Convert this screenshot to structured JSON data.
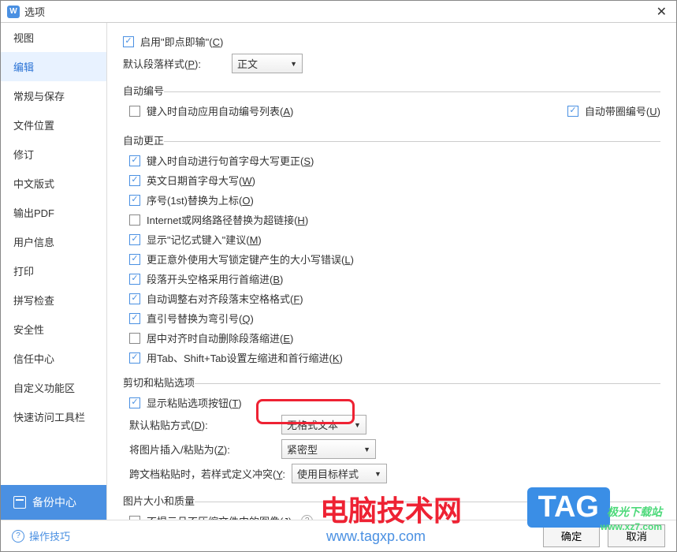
{
  "window": {
    "title": "选项",
    "close": "✕"
  },
  "sidebar": {
    "items": [
      {
        "label": "视图"
      },
      {
        "label": "编辑"
      },
      {
        "label": "常规与保存"
      },
      {
        "label": "文件位置"
      },
      {
        "label": "修订"
      },
      {
        "label": "中文版式"
      },
      {
        "label": "输出PDF"
      },
      {
        "label": "用户信息"
      },
      {
        "label": "打印"
      },
      {
        "label": "拼写检查"
      },
      {
        "label": "安全性"
      },
      {
        "label": "信任中心"
      },
      {
        "label": "自定义功能区"
      },
      {
        "label": "快速访问工具栏"
      }
    ],
    "backup": "备份中心"
  },
  "topRow": {
    "clickType": {
      "label": "启用\"即点即输\"(",
      "key": "C",
      "close": ")"
    },
    "paraStyle": {
      "label": "默认段落样式(",
      "key": "P",
      "close": "):",
      "value": "正文"
    }
  },
  "autoNum": {
    "legend": "自动编号",
    "applyList": {
      "label": "键入时自动应用自动编号列表(",
      "key": "A",
      "close": ")"
    },
    "circled": {
      "label": "自动带圈编号(",
      "key": "U",
      "close": ")"
    }
  },
  "autoCorrect": {
    "legend": "自动更正",
    "c1": {
      "label": "键入时自动进行句首字母大写更正(",
      "key": "S",
      "close": ")"
    },
    "c2": {
      "label": "英文日期首字母大写(",
      "key": "W",
      "close": ")"
    },
    "c3": {
      "label": "序号(1st)替换为上标(",
      "key": "O",
      "close": ")"
    },
    "c4": {
      "label": "Internet或网络路径替换为超链接(",
      "key": "H",
      "close": ")"
    },
    "c5": {
      "label": "显示\"记忆式键入\"建议(",
      "key": "M",
      "close": ")"
    },
    "c6": {
      "label": "更正意外使用大写锁定键产生的大小写错误(",
      "key": "L",
      "close": ")"
    },
    "c7": {
      "label": "段落开头空格采用行首缩进(",
      "key": "B",
      "close": ")"
    },
    "c8": {
      "label": "自动调整右对齐段落末空格格式(",
      "key": "F",
      "close": ")"
    },
    "c9": {
      "label": "直引号替换为弯引号(",
      "key": "Q",
      "close": ")"
    },
    "c10": {
      "label": "居中对齐时自动删除段落缩进(",
      "key": "E",
      "close": ")"
    },
    "c11": {
      "label": "用Tab、Shift+Tab设置左缩进和首行缩进(",
      "key": "K",
      "close": ")"
    }
  },
  "cutPaste": {
    "legend": "剪切和粘贴选项",
    "showBtn": {
      "label": "显示粘贴选项按钮(",
      "key": "T",
      "close": ")"
    },
    "defPaste": {
      "label": "默认粘贴方式(",
      "key": "D",
      "close": "):",
      "value": "无格式文本"
    },
    "imgPaste": {
      "label": "将图片插入/粘贴为(",
      "key": "Z",
      "close": "):",
      "value": "紧密型"
    },
    "crossDoc": {
      "label": "跨文档粘贴时，若样式定义冲突(",
      "key": "Y",
      "close": ":",
      "value": "使用目标样式"
    }
  },
  "imgSize": {
    "legend": "图片大小和质量",
    "noCompress": {
      "label": "不提示且不压缩文件中的图像(",
      "key": "J",
      "close": ")"
    },
    "help": "?"
  },
  "footer": {
    "tips": "操作技巧",
    "ok": "确定",
    "cancel": "取消"
  },
  "watermarks": {
    "wm1": "电脑技术网",
    "wm1url": "www.tagxp.com",
    "wm2": "TAG",
    "wm3": "极光下载站",
    "wm3url": "www.xz7.com"
  }
}
